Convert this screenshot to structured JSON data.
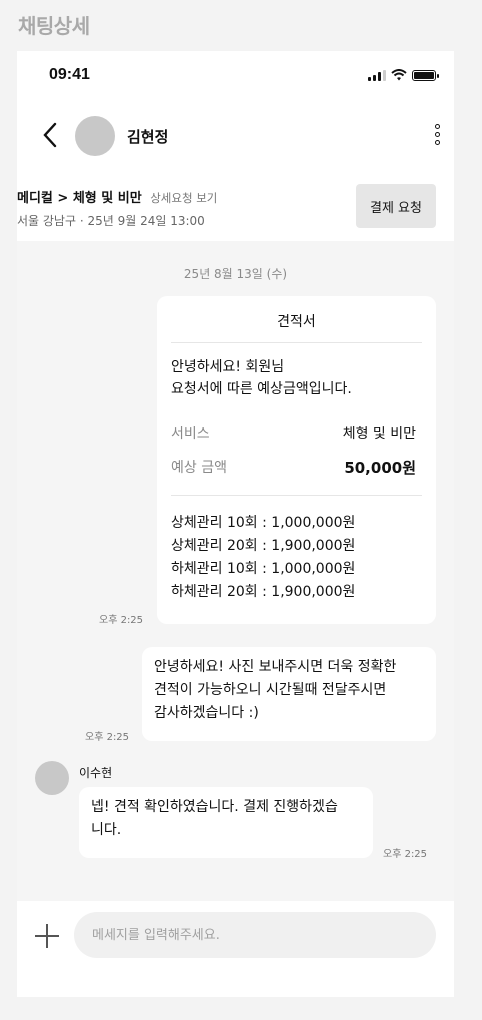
{
  "page_title": "채팅상세",
  "status_bar": {
    "time": "09:41"
  },
  "header": {
    "name": "김현정"
  },
  "info": {
    "category": "메디컬 > 체형 및 비만",
    "detail_link": "상세요청 보기",
    "meta": "서울 강남구 · 25년 9월 24일 13:00",
    "pay_button": "결제 요청"
  },
  "date_separator": "25년 8월 13일 (수)",
  "quote": {
    "title": "견적서",
    "greeting_1": "안녕하세요! 회원님",
    "greeting_2": "요청서에 따른 예상금액입니다.",
    "service_label": "서비스",
    "service_value": "체형 및 비만",
    "price_label": "예상 금액",
    "price_value": "50,000원",
    "items": [
      "상체관리 10회 : 1,000,000원",
      "상체관리 20회 : 1,900,000원",
      "하체관리 10회 : 1,000,000원",
      "하체관리 20회 : 1,900,000원"
    ],
    "time": "오후 2:25"
  },
  "messages": [
    {
      "lines": [
        "안녕하세요! 사진 보내주시면 더욱 정확한",
        "견적이 가능하오니 시간될때 전달주시면",
        "감사하겠습니다 :)"
      ],
      "time": "오후 2:25"
    },
    {
      "sender": "이수현",
      "lines": [
        "넵! 견적 확인하였습니다. 결제 진행하겠습",
        "니다."
      ],
      "time": "오후 2:25"
    }
  ],
  "composer": {
    "placeholder": "메세지를 입력해주세요."
  },
  "icons": [
    "back-chevron-icon",
    "more-vertical-icon",
    "signal-icon",
    "wifi-icon",
    "battery-icon",
    "plus-icon"
  ]
}
